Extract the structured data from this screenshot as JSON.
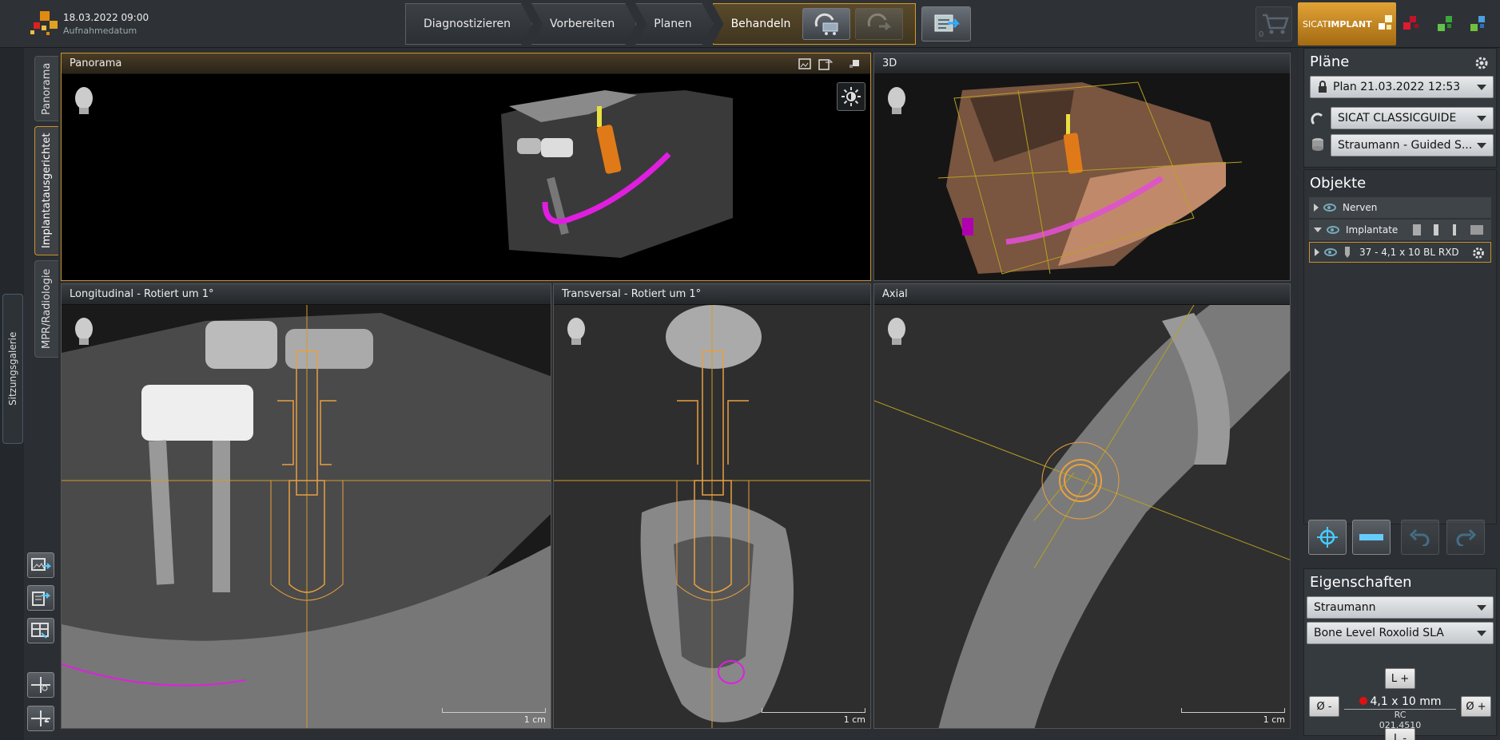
{
  "header": {
    "date": "18.03.2022 09:00",
    "date_label": "Aufnahmedatum"
  },
  "workflow": {
    "steps": [
      "Diagnostizieren",
      "Vorbereiten",
      "Planen",
      "Behandeln"
    ]
  },
  "cart": {
    "count": "0"
  },
  "brand": {
    "name_light": "SICAT",
    "name_bold": "IMPLANT"
  },
  "left_tabs": [
    "Panorama",
    "Implantatausgerichtet",
    "MPR/Radiologie"
  ],
  "gallery_tab": "Sitzungsgalerie",
  "viewports": {
    "panorama": {
      "title": "Panorama"
    },
    "three_d": {
      "title": "3D"
    },
    "longitudinal": {
      "title": "Longitudinal - Rotiert um 1°",
      "scale": "1 cm"
    },
    "transversal": {
      "title": "Transversal - Rotiert um 1°",
      "scale": "1 cm"
    },
    "axial": {
      "title": "Axial",
      "scale": "1 cm"
    }
  },
  "panel": {
    "plans_title": "Pläne",
    "plan_select": "Plan 21.03.2022 12:53",
    "guide_select": "SICAT CLASSICGUIDE",
    "sleeve_select": "Straumann - Guided S...",
    "objects_title": "Objekte",
    "objects": {
      "nerves": "Nerven",
      "implants": "Implantate",
      "implant_item": "37 - 4,1 x 10 BL RXD"
    },
    "props_title": "Eigenschaften",
    "manufacturer": "Straumann",
    "product_line": "Bone Level Roxolid SLA",
    "length_plus": "L +",
    "length_minus": "L -",
    "diam_minus": "Ø -",
    "diam_plus": "Ø +",
    "size": "4,1 x 10 mm",
    "platform": "RC",
    "article": "021.4510"
  },
  "colors": {
    "accent": "#c9902a",
    "nerve": "#e01ee0",
    "implant": "#e8a040"
  }
}
